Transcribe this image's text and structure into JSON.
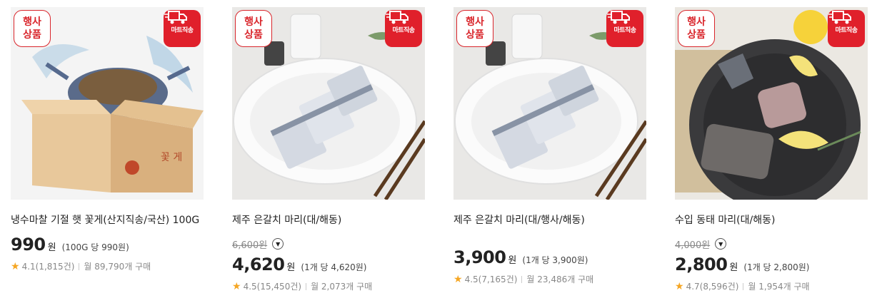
{
  "products": [
    {
      "event_badge": "행사 상품",
      "delivery_badge": "마트직송",
      "title": "냉수마찰 기절 햇 꽃게(산지직송/국산) 100G",
      "original_price": "",
      "price": "990",
      "price_unit": "원",
      "unit_price": "(100G 당 990원)",
      "rating": "4.1",
      "reviews": "(1,815건)",
      "monthly": "월 89,790개 구매",
      "image": "blue-crab-in-box"
    },
    {
      "event_badge": "행사 상품",
      "delivery_badge": "마트직송",
      "title": "제주 은갈치 마리(대/해동)",
      "original_price": "6,600원",
      "price": "4,620",
      "price_unit": "원",
      "unit_price": "(1개 당 4,620원)",
      "rating": "4.5",
      "reviews": "(15,450건)",
      "monthly": "월 2,073개 구매",
      "image": "hairtail-on-plate"
    },
    {
      "event_badge": "행사 상품",
      "delivery_badge": "마트직송",
      "title": "제주 은갈치 마리(대/행사/해동)",
      "original_price": "",
      "price": "3,900",
      "price_unit": "원",
      "unit_price": "(1개 당 3,900원)",
      "rating": "4.5",
      "reviews": "(7,165건)",
      "monthly": "월 23,486개 구매",
      "image": "hairtail-on-plate"
    },
    {
      "event_badge": "행사 상품",
      "delivery_badge": "마트직송",
      "title": "수입 동태 마리(대/해동)",
      "original_price": "4,000원",
      "price": "2,800",
      "price_unit": "원",
      "unit_price": "(1개 당 2,800원)",
      "rating": "4.7",
      "reviews": "(8,596건)",
      "monthly": "월 1,954개 구매",
      "image": "pollock-in-bowl"
    }
  ],
  "colors": {
    "badge_red": "#e0202b",
    "star": "#f5a623"
  }
}
